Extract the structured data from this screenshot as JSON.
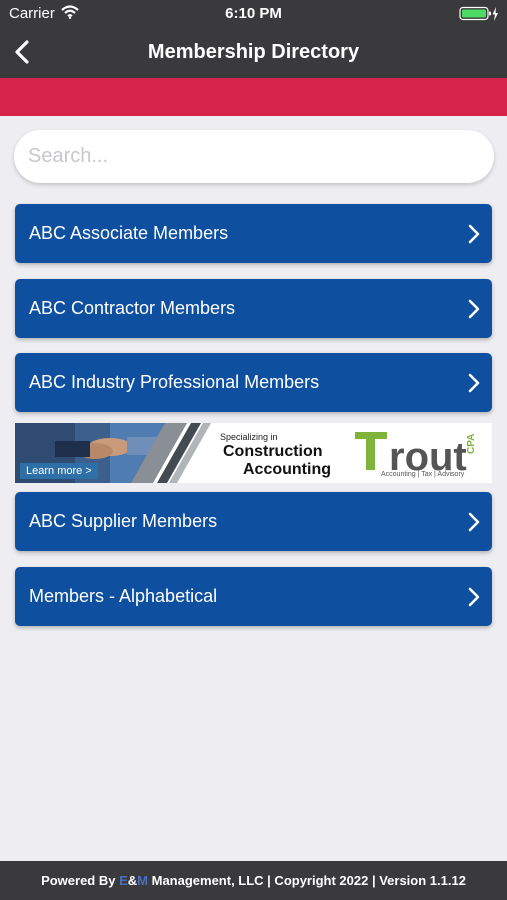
{
  "status_bar": {
    "carrier": "Carrier",
    "time": "6:10 PM"
  },
  "nav": {
    "title": "Membership Directory",
    "back_icon": "chevron-left-icon"
  },
  "colors": {
    "bar": "#3a3a3c",
    "accent_red": "#d5244a",
    "button_blue": "#0e4fa0",
    "background": "#eeeef2"
  },
  "search": {
    "placeholder": "Search...",
    "value": ""
  },
  "menu": [
    {
      "label": "ABC Associate Members"
    },
    {
      "label": "ABC Contractor Members"
    },
    {
      "label": "ABC Industry Professional Members"
    },
    {
      "label": "ABC Supplier Members"
    },
    {
      "label": "Members - Alphabetical"
    }
  ],
  "ad": {
    "learn_more": "Learn more >",
    "tagline_small": "Specializing in",
    "tagline_line1": "Construction",
    "tagline_line2": "Accounting",
    "brand": "Trout",
    "brand_suffix": "CPA",
    "brand_sub": "Accounting | Tax | Advisory"
  },
  "footer": {
    "prefix": "Powered By ",
    "highlight1": "E",
    "amp": "&",
    "highlight2": "M",
    "suffix": " Management, LLC | Copyright 2022 | Version 1.1.12"
  }
}
